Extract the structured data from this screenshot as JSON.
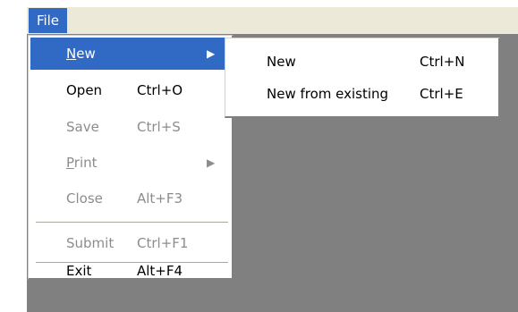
{
  "menubar": {
    "file_label": "File"
  },
  "file_menu": {
    "items": [
      {
        "label": "New",
        "mnemonic": "N",
        "rest": "ew",
        "shortcut": "",
        "submenu": true,
        "state": "highlighted"
      },
      {
        "label": "Open",
        "shortcut": "Ctrl+O",
        "state": "enabled"
      },
      {
        "label": "Save",
        "shortcut": "Ctrl+S",
        "state": "disabled"
      },
      {
        "label": "Print",
        "mnemonic": "P",
        "rest": "rint",
        "shortcut": "",
        "submenu": true,
        "state": "disabled"
      },
      {
        "label": "Close",
        "shortcut": "Alt+F3",
        "state": "disabled"
      },
      {
        "label": "Submit",
        "shortcut": "Ctrl+F1",
        "state": "disabled"
      },
      {
        "label": "Exit",
        "shortcut": "Alt+F4",
        "state": "enabled"
      }
    ]
  },
  "new_submenu": {
    "items": [
      {
        "label": "New",
        "shortcut": "Ctrl+N"
      },
      {
        "label": "New from existing",
        "shortcut": "Ctrl+E"
      }
    ]
  },
  "colors": {
    "highlight": "#316ac5",
    "menubar": "#ece9d8",
    "workspace": "#808080",
    "disabled_text": "#8c8c8c"
  },
  "icons": {
    "submenu_arrow": "submenu-arrow-icon"
  }
}
